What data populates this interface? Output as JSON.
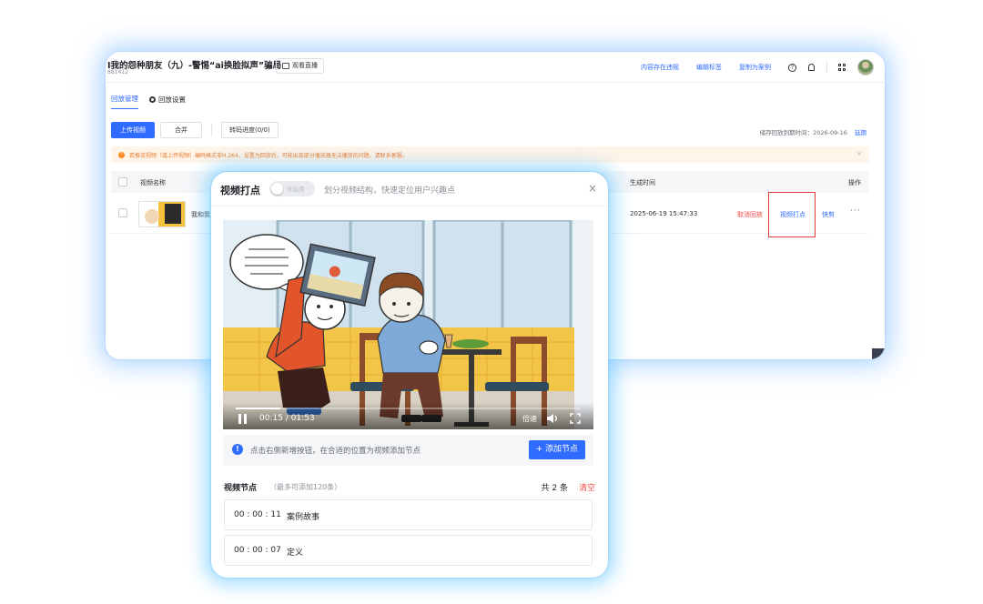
{
  "console": {
    "room_title": "I我的怨种朋友（九）-警惕“ai换脸拟声”骗局",
    "room_id": "881412",
    "watch_live_label": "观看直播",
    "top_links": [
      "内容存在违规",
      "编辑标签",
      "复制为案例"
    ],
    "tabs": [
      {
        "label": "回放管理",
        "active": true
      },
      {
        "label": "回放设置",
        "active": false
      }
    ],
    "toolbar": {
      "upload_label": "上传视频",
      "merge_label": "合并",
      "transcode_label": "转码进度(0/0)"
    },
    "expire": {
      "text": "储存回放到期时间：2026-09-16",
      "renew_label": "延期"
    },
    "warning": {
      "text": "若推流视频（或上传视频）编码格式非H.264，设置为回放后，可能出现部分播放器无法播放的问题，请联系客服。",
      "close": "×"
    },
    "table": {
      "headers": {
        "name": "视频名称",
        "time": "生成时间",
        "ops": "操作"
      },
      "rows": [
        {
          "title": "我和我",
          "time": "2025-06-19 15:47:33",
          "op_cancel": "取消回放",
          "op_mark": "视频打点",
          "op_clip": "快剪",
          "op_more": "···"
        }
      ]
    }
  },
  "modal": {
    "title": "视频打点",
    "toggle_text": "未启用",
    "toggle_on": false,
    "subtitle": "划分视频结构，快速定位用户兴趣点",
    "close": "×",
    "player": {
      "current_time": "00:15",
      "duration": "01:53",
      "progress": 0.13,
      "speed_label": "倍速"
    },
    "tip": {
      "text": "点击右侧新增按钮，在合适的位置为视频添加节点",
      "add_label": "+ 添加节点"
    },
    "nodes": {
      "title": "视频节点",
      "limit": "（最多可添加120条）",
      "count": "共 2 条",
      "clear": "清空",
      "items": [
        {
          "time": "00 : 00 : 11",
          "label": "案例故事"
        },
        {
          "time": "00 : 00 : 07",
          "label": "定义"
        }
      ]
    }
  },
  "colors": {
    "accent": "#2f6bff",
    "danger": "#f54a45",
    "warning": "#ff8a1f"
  }
}
